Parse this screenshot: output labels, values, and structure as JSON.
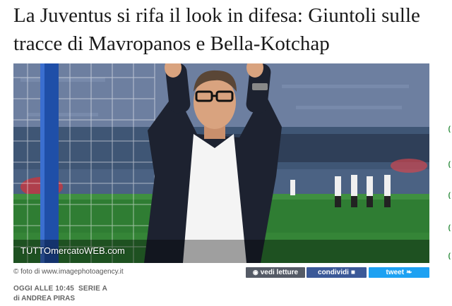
{
  "article": {
    "title": "La Juventus si rifa il look in difesa: Giuntoli sulle tracce di Mavropanos e Bella-Kotchap",
    "watermark": "TUTTOmercatoWEB.com",
    "photo_credit": "© foto di www.imagephotoagency.it",
    "date": "OGGI ALLE 10:45",
    "category": "SERIE A",
    "author": "di ANDREA PIRAS"
  },
  "actions": {
    "letture_label": "vedi letture",
    "share_label": "condividi",
    "tweet_label": "tweet"
  },
  "colors": {
    "letture_bg": "#555b66",
    "facebook_bg": "#3b5998",
    "twitter_bg": "#1da1f2"
  }
}
